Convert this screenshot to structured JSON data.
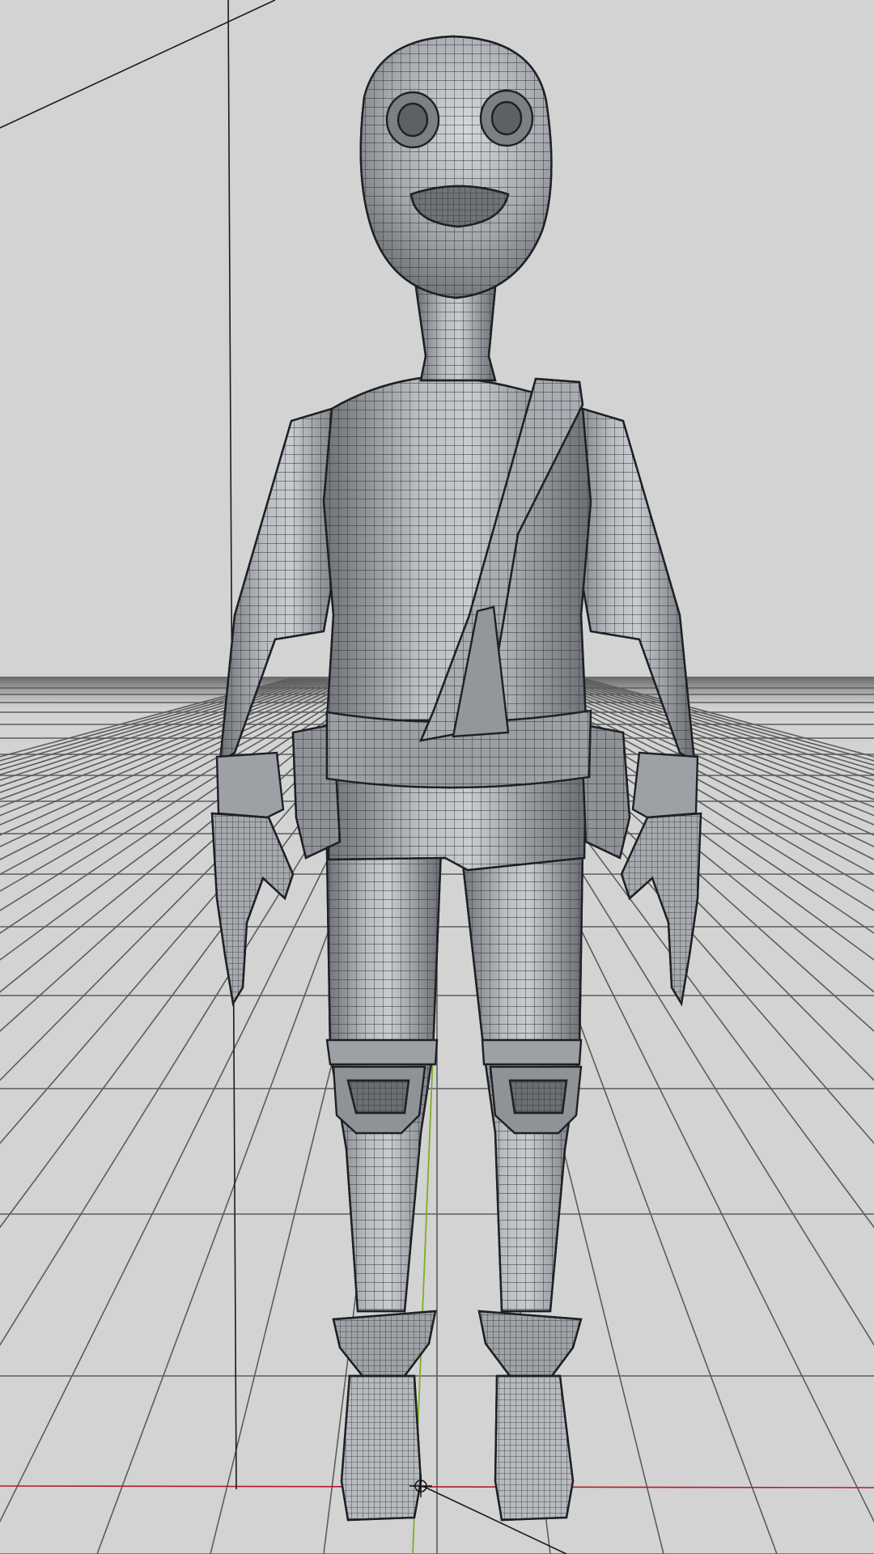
{
  "viewport": {
    "background_color": "#d3d3d3",
    "floor_grid_color": "#5c5c5c",
    "world_axis_x_color": "#b01e2a",
    "world_axis_y_color": "#7fae26",
    "bounding_line_color": "#1a1a1a",
    "model_color": "#a2a6ab",
    "wire_color": "#2c2f33"
  },
  "model": {
    "kind": "character",
    "parts": [
      "head",
      "neck",
      "torso",
      "shoulder-strap",
      "belt",
      "left-pouch",
      "right-pouch",
      "left-arm",
      "right-arm",
      "left-hand",
      "right-hand",
      "left-leg",
      "right-leg",
      "left-knee-pad",
      "right-knee-pad",
      "left-boot",
      "right-boot"
    ]
  },
  "icons": {
    "pivot": "pivot-crosshair-icon"
  }
}
